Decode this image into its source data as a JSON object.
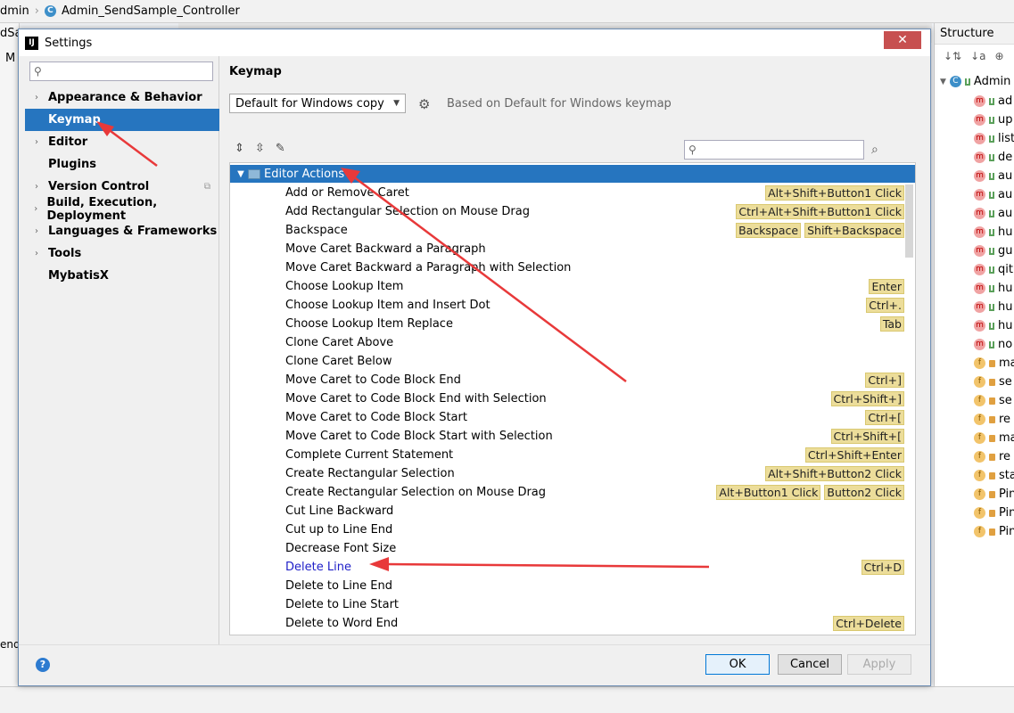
{
  "ide": {
    "breadcrumb_prefix": "dmin",
    "breadcrumb_class": "Admin_SendSample_Controller",
    "left_fragment_1": "dSa",
    "left_fragment_2": "M",
    "left_fragment_3": "end",
    "structure_title": "Structure",
    "structure_root": "Admin",
    "structure_items": [
      {
        "badge": "m",
        "text": "ad"
      },
      {
        "badge": "m",
        "text": "up"
      },
      {
        "badge": "m",
        "text": "list"
      },
      {
        "badge": "m",
        "text": "de"
      },
      {
        "badge": "m",
        "text": "au"
      },
      {
        "badge": "m",
        "text": "au"
      },
      {
        "badge": "m",
        "text": "au"
      },
      {
        "badge": "m",
        "text": "hu"
      },
      {
        "badge": "m",
        "text": "gu"
      },
      {
        "badge": "m",
        "text": "qit"
      },
      {
        "badge": "m",
        "text": "hu"
      },
      {
        "badge": "m",
        "text": "hu"
      },
      {
        "badge": "m",
        "text": "hu"
      },
      {
        "badge": "m",
        "text": "no"
      },
      {
        "badge": "f",
        "text": "ma"
      },
      {
        "badge": "f",
        "text": "se"
      },
      {
        "badge": "f",
        "text": "se"
      },
      {
        "badge": "f",
        "text": "re"
      },
      {
        "badge": "f",
        "text": "ma"
      },
      {
        "badge": "f",
        "text": "re"
      },
      {
        "badge": "f",
        "text": "sta"
      },
      {
        "badge": "f",
        "text": "Pin"
      },
      {
        "badge": "f",
        "text": "Pin"
      },
      {
        "badge": "f",
        "text": "Pin"
      }
    ]
  },
  "dialog": {
    "title": "Settings",
    "close_glyph": "✕",
    "search_placeholder": "",
    "nav": [
      {
        "label": "Appearance & Behavior",
        "arrow": true
      },
      {
        "label": "Keymap",
        "arrow": false,
        "selected": true
      },
      {
        "label": "Editor",
        "arrow": true
      },
      {
        "label": "Plugins",
        "arrow": false
      },
      {
        "label": "Version Control",
        "arrow": true
      },
      {
        "label": "Build, Execution, Deployment",
        "arrow": true
      },
      {
        "label": "Languages & Frameworks",
        "arrow": true
      },
      {
        "label": "Tools",
        "arrow": true
      },
      {
        "label": "MybatisX",
        "arrow": false
      }
    ],
    "content_title": "Keymap",
    "scheme_value": "Default for Windows copy",
    "based_on": "Based on Default for Windows keymap",
    "tree_group": "Editor Actions",
    "actions": [
      {
        "name": "Add or Remove Caret",
        "keys": [
          "Alt+Shift+Button1 Click"
        ]
      },
      {
        "name": "Add Rectangular Selection on Mouse Drag",
        "keys": [
          "Ctrl+Alt+Shift+Button1 Click"
        ]
      },
      {
        "name": "Backspace",
        "keys": [
          "Backspace",
          "Shift+Backspace"
        ]
      },
      {
        "name": "Move Caret Backward a Paragraph",
        "keys": []
      },
      {
        "name": "Move Caret Backward a Paragraph with Selection",
        "keys": []
      },
      {
        "name": "Choose Lookup Item",
        "keys": [
          "Enter"
        ]
      },
      {
        "name": "Choose Lookup Item and Insert Dot",
        "keys": [
          "Ctrl+."
        ]
      },
      {
        "name": "Choose Lookup Item Replace",
        "keys": [
          "Tab"
        ]
      },
      {
        "name": "Clone Caret Above",
        "keys": []
      },
      {
        "name": "Clone Caret Below",
        "keys": []
      },
      {
        "name": "Move Caret to Code Block End",
        "keys": [
          "Ctrl+]"
        ]
      },
      {
        "name": "Move Caret to Code Block End with Selection",
        "keys": [
          "Ctrl+Shift+]"
        ]
      },
      {
        "name": "Move Caret to Code Block Start",
        "keys": [
          "Ctrl+["
        ]
      },
      {
        "name": "Move Caret to Code Block Start with Selection",
        "keys": [
          "Ctrl+Shift+["
        ]
      },
      {
        "name": "Complete Current Statement",
        "keys": [
          "Ctrl+Shift+Enter"
        ]
      },
      {
        "name": "Create Rectangular Selection",
        "keys": [
          "Alt+Shift+Button2 Click"
        ]
      },
      {
        "name": "Create Rectangular Selection on Mouse Drag",
        "keys": [
          "Alt+Button1 Click",
          "Button2 Click"
        ]
      },
      {
        "name": "Cut Line Backward",
        "keys": []
      },
      {
        "name": "Cut up to Line End",
        "keys": []
      },
      {
        "name": "Decrease Font Size",
        "keys": []
      },
      {
        "name": "Delete Line",
        "keys": [
          "Ctrl+D"
        ],
        "highlight": true
      },
      {
        "name": "Delete to Line End",
        "keys": []
      },
      {
        "name": "Delete to Line Start",
        "keys": []
      },
      {
        "name": "Delete to Word End",
        "keys": [
          "Ctrl+Delete"
        ]
      }
    ],
    "buttons": {
      "ok": "OK",
      "cancel": "Cancel",
      "apply": "Apply"
    },
    "help_glyph": "?"
  },
  "colors": {
    "selection": "#2675bf",
    "shortcut_bg": "#ecdd9a",
    "arrow": "#e8393a",
    "link": "#2020c8"
  }
}
